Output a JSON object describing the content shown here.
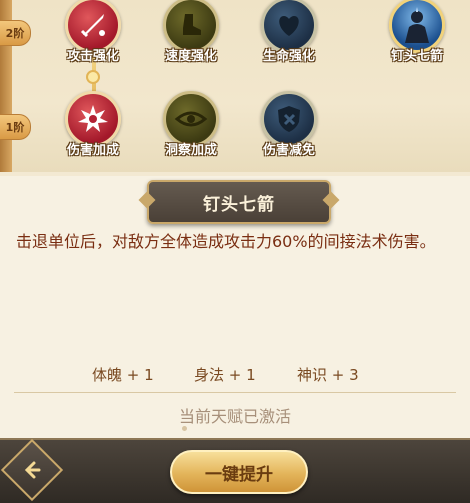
{
  "tiers": {
    "tier2_label": "2阶",
    "tier1_label": "1阶"
  },
  "talents": {
    "row1": [
      {
        "label": "攻击强化",
        "icon": "sword-icon",
        "color": "#b32134"
      },
      {
        "label": "速度强化",
        "icon": "boot-icon",
        "color": "#4a4617"
      },
      {
        "label": "生命强化",
        "icon": "heart-icon",
        "color": "#26394f"
      },
      {
        "label": "钉头七箭",
        "icon": "character-portrait-icon",
        "color": "#1b4f8e"
      }
    ],
    "row2": [
      {
        "label": "伤害加成",
        "icon": "burst-icon",
        "color": "#b32134"
      },
      {
        "label": "洞察加成",
        "icon": "eye-icon",
        "color": "#4a4617"
      },
      {
        "label": "伤害减免",
        "icon": "shield-icon",
        "color": "#26394f"
      }
    ]
  },
  "detail": {
    "title": "钉头七箭",
    "description": "击退单位后，对敌方全体造成攻击力60%的间接法术伤害。",
    "stats": [
      {
        "text": "体魄 + 1"
      },
      {
        "text": "身法 + 1"
      },
      {
        "text": "神识 + 3"
      }
    ],
    "status": "当前天赋已激活"
  },
  "bottom_bar": {
    "upgrade_label": "一键提升",
    "back_icon": "back-arrow-icon"
  }
}
